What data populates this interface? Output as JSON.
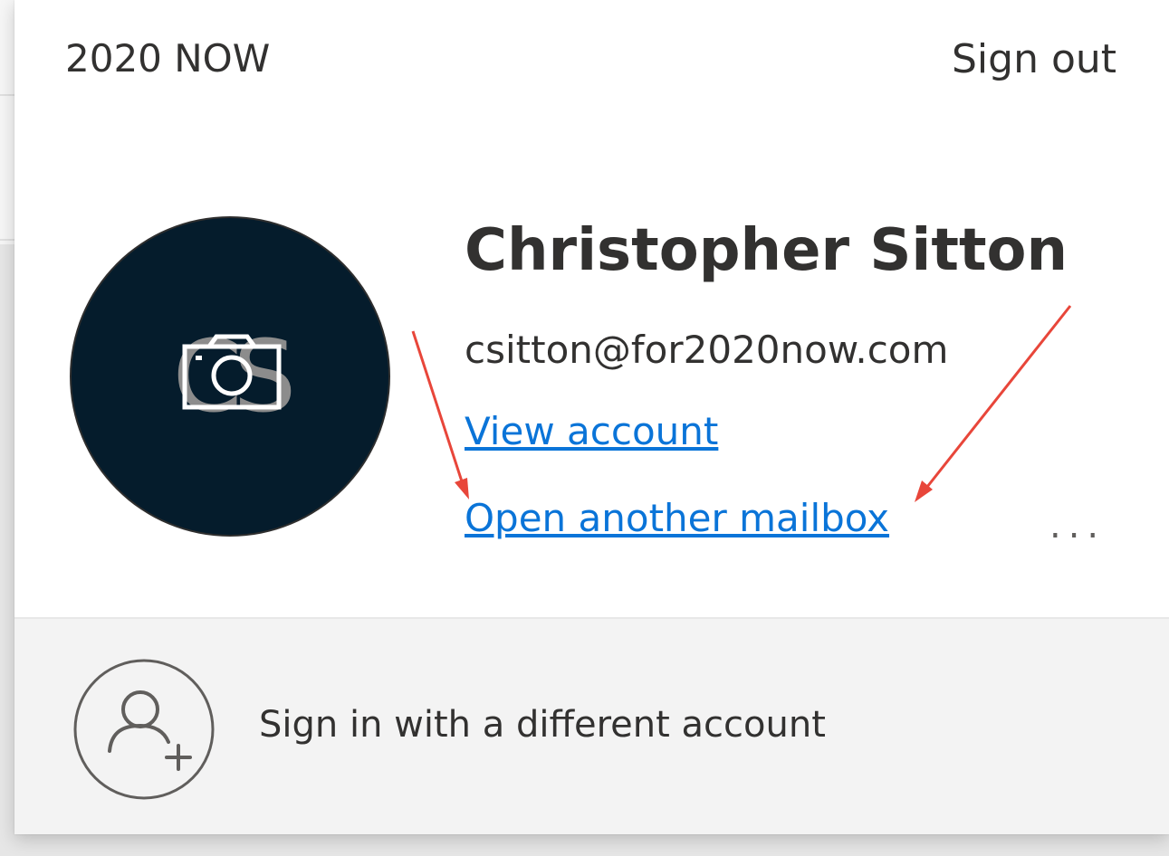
{
  "header": {
    "org_name": "2020 NOW",
    "sign_out_label": "Sign out"
  },
  "profile": {
    "avatar_initials": "CS",
    "avatar_icon": "camera-icon",
    "avatar_color": "#051c2c",
    "name": "Christopher Sitton",
    "email": "csitton@for2020now.com",
    "view_account_label": "View account",
    "open_mailbox_label": "Open another mailbox",
    "more_label": "..."
  },
  "footer": {
    "icon": "add-person-icon",
    "label": "Sign in with a different account"
  },
  "colors": {
    "link": "#0a74d8",
    "text": "#323130",
    "annotation_arrow": "#e8463a",
    "footer_bg": "#f3f3f3"
  }
}
